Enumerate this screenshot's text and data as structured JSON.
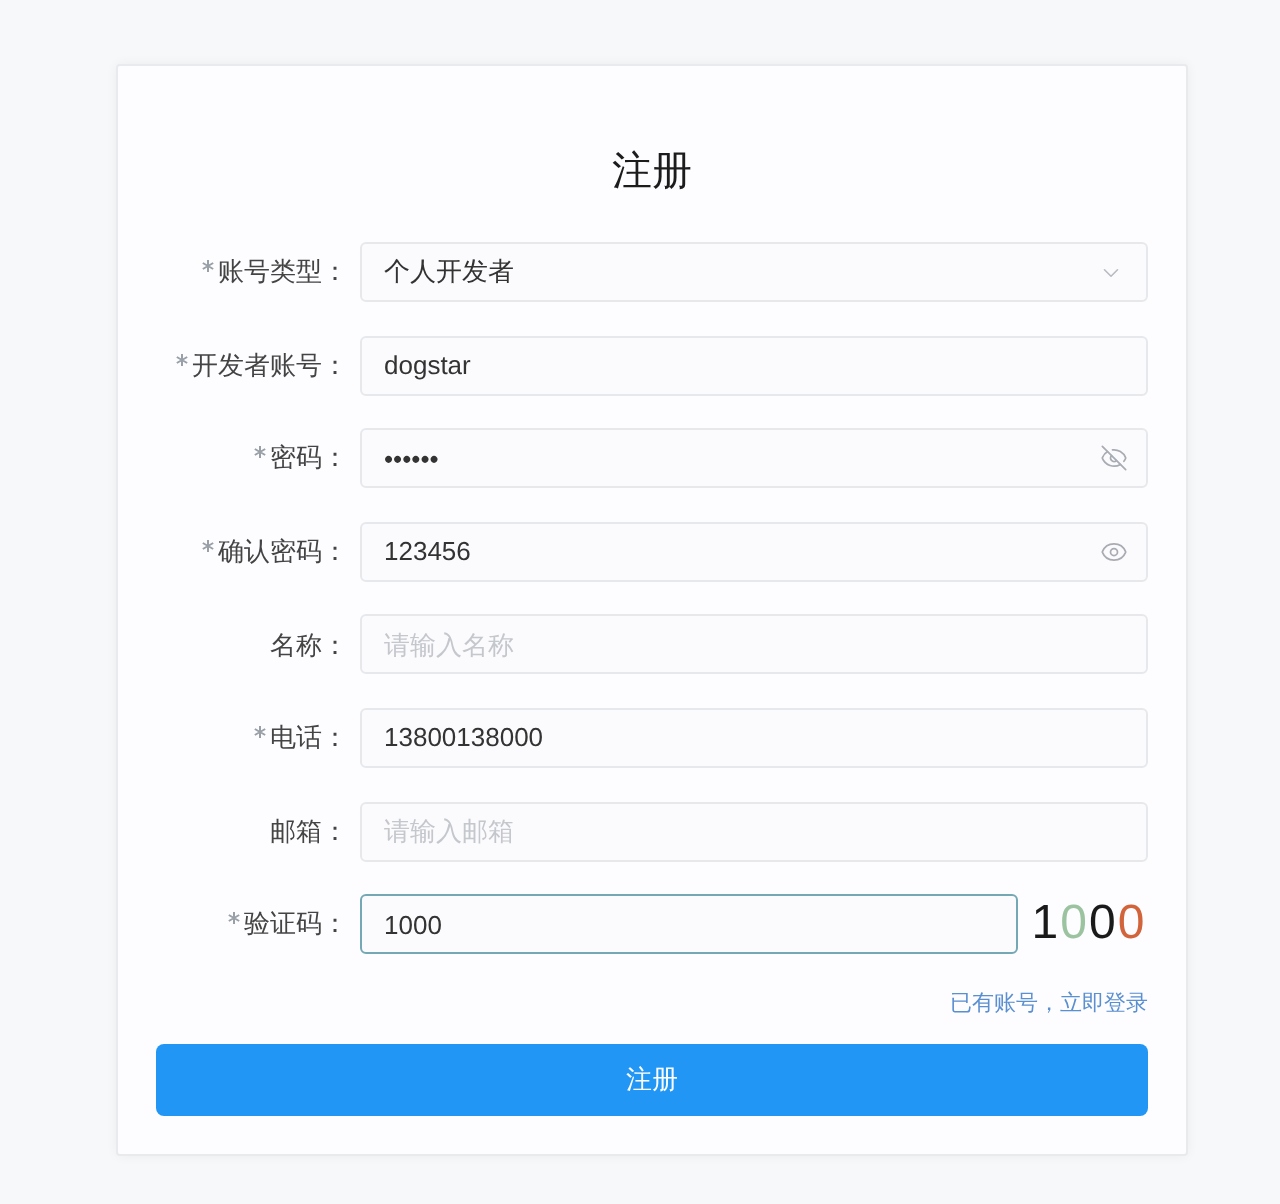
{
  "title": "注册",
  "fields": [
    {
      "kind": "select",
      "label": "账号类型：",
      "required": true,
      "focused": false,
      "value": "个人开发者"
    },
    {
      "kind": "text",
      "label": "开发者账号：",
      "required": true,
      "focused": false,
      "value": "dogstar"
    },
    {
      "kind": "password",
      "label": "密码：",
      "required": true,
      "focused": false,
      "value": "••••••",
      "visible": false
    },
    {
      "kind": "password",
      "label": "确认密码：",
      "required": true,
      "focused": false,
      "value": "123456",
      "visible": true
    },
    {
      "kind": "text",
      "label": "名称：",
      "required": false,
      "focused": false,
      "placeholder": "请输入名称"
    },
    {
      "kind": "text",
      "label": "电话：",
      "required": true,
      "focused": false,
      "value": "13800138000"
    },
    {
      "kind": "text",
      "label": "邮箱：",
      "required": false,
      "focused": false,
      "placeholder": "请输入邮箱"
    },
    {
      "kind": "captcha",
      "label": "验证码：",
      "required": true,
      "focused": true,
      "value": "1000",
      "code": [
        {
          "char": "1",
          "color": "#1a1a1a"
        },
        {
          "char": "0",
          "color": "#9cc3a0"
        },
        {
          "char": "0",
          "color": "#1a1a1a"
        },
        {
          "char": "0",
          "color": "#d2643c"
        }
      ]
    }
  ],
  "login_link": "已有账号，立即登录",
  "submit_button": "注册"
}
